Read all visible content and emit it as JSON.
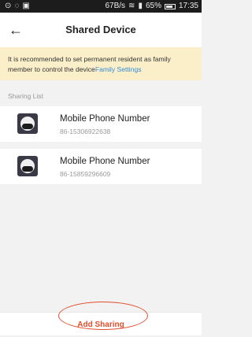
{
  "status_bar": {
    "network_speed": "67B/s",
    "battery": "65%",
    "time": "17:35"
  },
  "header": {
    "title": "Shared Device",
    "back_icon": "arrow-left-icon"
  },
  "notice": {
    "text": "It is recommended to set permanent resident as family member to control the device",
    "link": "Family Settings"
  },
  "sharing_list": {
    "label": "Sharing List",
    "items": [
      {
        "title": "Mobile Phone Number",
        "phone": "86-15306922638"
      },
      {
        "title": "Mobile Phone Number",
        "phone": "86-15859296609"
      }
    ]
  },
  "footer": {
    "add_label": "Add Sharing",
    "accent": "#e04e2b"
  }
}
